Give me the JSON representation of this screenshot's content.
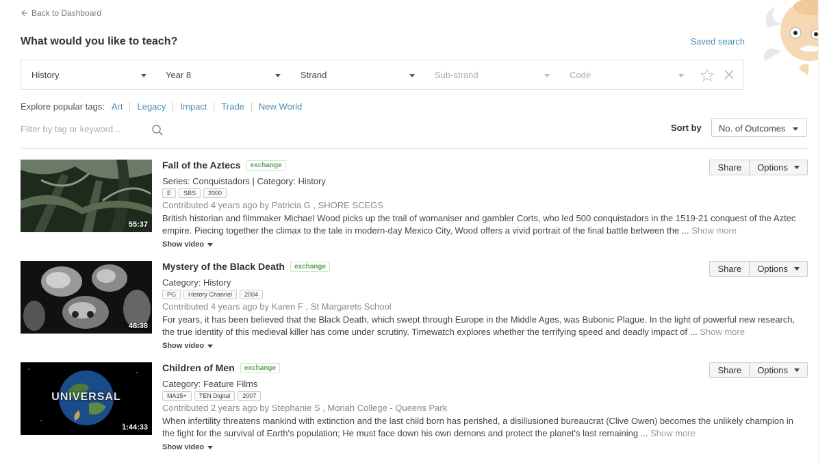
{
  "nav": {
    "back_label": "Back to Dashboard"
  },
  "header": {
    "title": "What would you like to teach?",
    "saved_search": "Saved search"
  },
  "filters": {
    "subject": "History",
    "year": "Year 8",
    "strand": "Strand",
    "substrand": "Sub-strand",
    "code": "Code"
  },
  "tags": {
    "label": "Explore popular tags:",
    "items": [
      "Art",
      "Legacy",
      "Impact",
      "Trade",
      "New World"
    ]
  },
  "search": {
    "placeholder": "Filter by tag or keyword..."
  },
  "sort": {
    "label": "Sort by",
    "value": "No. of Outcomes"
  },
  "results": [
    {
      "title": "Fall of the Aztecs",
      "badge": "exchange",
      "category": "Series: Conquistadors | Category: History",
      "tags": [
        "E",
        "SBS",
        "2000"
      ],
      "contributed": "Contributed 4 years ago by Patricia G , SHORE SCEGS",
      "description": "British historian and filmmaker Michael Wood picks up the trail of womaniser and gambler Corts, who led 500 conquistadors in the 1519-21 conquest of the Aztec empire. Piecing together the climax to the tale in modern-day Mexico City, Wood offers a vivid portrait of the final battle between the ...",
      "show_more": "Show more",
      "duration": "55:37",
      "show_video": "Show video",
      "share": "Share",
      "options": "Options"
    },
    {
      "title": "Mystery of the Black Death",
      "badge": "exchange",
      "category": "Category: History",
      "tags": [
        "PG",
        "History Channel",
        "2004"
      ],
      "contributed": "Contributed 4 years ago by Karen F , St Margarets School",
      "description": "For years, it has been believed that the Black Death, which swept through Europe in the Middle Ages, was Bubonic Plague. In the light of powerful new research, the true identity of this medieval killer has come under scrutiny. Timewatch explores whether the terrifying speed and deadly impact of ...",
      "show_more": "Show more",
      "duration": "48:38",
      "show_video": "Show video",
      "share": "Share",
      "options": "Options"
    },
    {
      "title": "Children of Men",
      "badge": "exchange",
      "category": "Category: Feature Films",
      "tags": [
        "MA15+",
        "TEN Digital",
        "2007"
      ],
      "contributed": "Contributed 2 years ago by Stephanie S , Moriah College - Queens Park",
      "description": "When infertility threatens mankind with extinction and the last child born has perished, a disillusioned bureaucrat (Clive Owen) becomes the unlikely champion in the fight for the survival of Earth's population; He must face down his own demons and protect the planet's last remaining ...",
      "show_more": "Show more",
      "duration": "1:44:33",
      "thumb_text": "UNIVERSAL",
      "show_video": "Show video",
      "share": "Share",
      "options": "Options"
    }
  ]
}
